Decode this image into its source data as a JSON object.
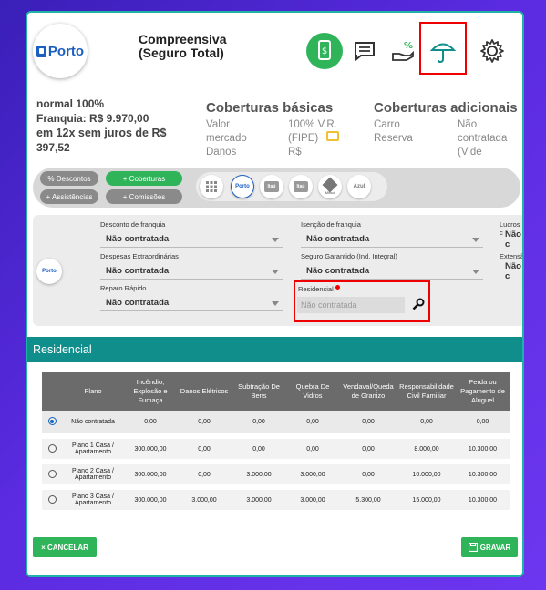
{
  "header": {
    "logo_text": "Porto",
    "title_line1": "Compreensiva",
    "title_line2": "(Seguro Total)"
  },
  "summary": {
    "line1": "normal 100%",
    "line2": "Franquia: R$ 9.970,00",
    "line3": "em 12x sem juros de R$",
    "line4": "397,52",
    "basic_title": "Coberturas básicas",
    "basic_rows": [
      [
        "Valor",
        "100% V.R."
      ],
      [
        "mercado",
        "(FIPE)"
      ],
      [
        "Danos",
        "R$"
      ]
    ],
    "additional_title": "Coberturas adicionais",
    "additional_rows": [
      [
        "Carro",
        "Não"
      ],
      [
        "Reserva",
        "contratada"
      ],
      [
        "",
        "(Vide"
      ]
    ]
  },
  "filters": {
    "descontos": "% Descontos",
    "coberturas": "+ Coberturas",
    "assistencias": "+ Assistências",
    "comissoes": "+ Comissões"
  },
  "insurers": [
    "Porto",
    "Itaú",
    "Itaú",
    "Mitsui",
    "Azul"
  ],
  "form": {
    "logo_text": "Porto",
    "desconto_label": "Desconto de franquia",
    "desconto_value": "Não contratada",
    "isencao_label": "Isenção de franquia",
    "isencao_value": "Não contratada",
    "lucros_label": "Lucros c",
    "lucros_value": "Não c",
    "despesas_label": "Despesas Extraordinárias",
    "despesas_value": "Não contratada",
    "seguro_label": "Seguro Garantido (Ind. Integral)",
    "seguro_value": "Não contratada",
    "extensao_label": "Extensã",
    "extensao_value": "Não c",
    "reparo_label": "Reparo Rápido",
    "reparo_value": "Não contratada",
    "residencial_label": "Residencial",
    "residencial_placeholder": "Não contratada"
  },
  "residencial": {
    "section_title": "Residencial",
    "columns": [
      "",
      "Plano",
      "Incêndio, Explosão e Fumaça",
      "Danos Elétricos",
      "Subtração De Bens",
      "Quebra De Vidros",
      "Vendaval/Queda de Granizo",
      "Responsabilidade Civil Familiar",
      "Perda ou Pagamento de Aluguel"
    ],
    "rows": [
      {
        "plano": "Não contratada",
        "v": [
          "0,00",
          "0,00",
          "0,00",
          "0,00",
          "0,00",
          "0,00",
          "0,00"
        ],
        "selected": true
      },
      {
        "plano": "Plano 1 Casa / Apartamento",
        "v": [
          "300.000,00",
          "0,00",
          "0,00",
          "0,00",
          "0,00",
          "8.000,00",
          "10.300,00"
        ],
        "selected": false
      },
      {
        "plano": "Plano 2 Casa / Apartamento",
        "v": [
          "300.000,00",
          "0,00",
          "3.000,00",
          "3.000,00",
          "0,00",
          "10.000,00",
          "10.300,00"
        ],
        "selected": false
      },
      {
        "plano": "Plano 3 Casa / Apartamento",
        "v": [
          "300.000,00",
          "3.000,00",
          "3.000,00",
          "3.000,00",
          "5.300,00",
          "15.000,00",
          "10.300,00"
        ],
        "selected": false
      }
    ]
  },
  "actions": {
    "cancel": "× CANCELAR",
    "save": "GRAVAR"
  },
  "colors": {
    "accent_green": "#2fb45a",
    "teal": "#0f8e8c",
    "highlight_red": "#e00000",
    "brand_blue": "#1b5fc1"
  }
}
